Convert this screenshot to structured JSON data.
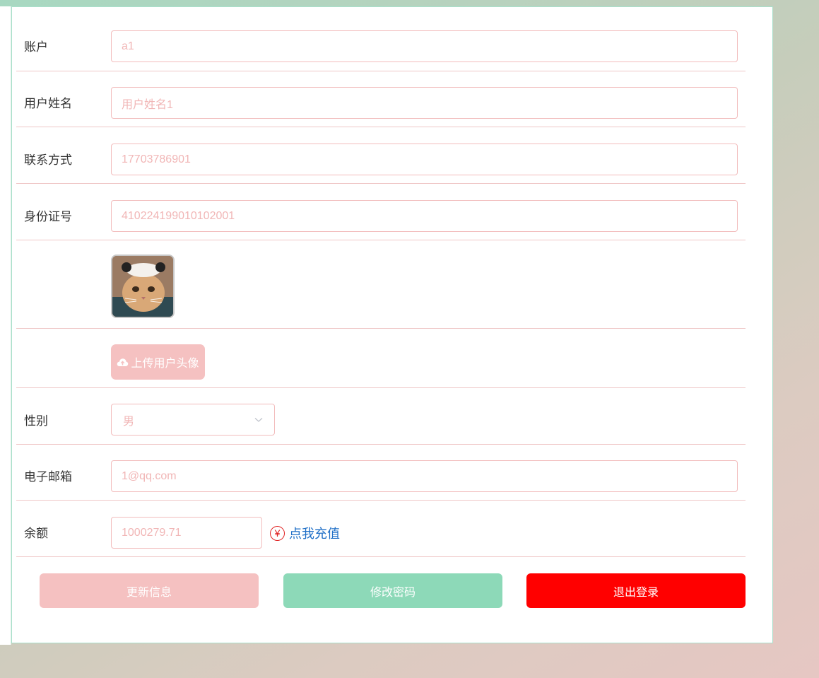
{
  "form": {
    "account": {
      "label": "账户",
      "value": "a1"
    },
    "username": {
      "label": "用户姓名",
      "value": "用户姓名1"
    },
    "phone": {
      "label": "联系方式",
      "value": "17703786901"
    },
    "id_number": {
      "label": "身份证号",
      "value": "410224199010102001"
    },
    "upload_button": "上传用户头像",
    "gender": {
      "label": "性别",
      "value": "男"
    },
    "email": {
      "label": "电子邮箱",
      "value": "1@qq.com"
    },
    "balance": {
      "label": "余额",
      "value": "1000279.71",
      "recharge_label": "点我充值",
      "recharge_icon": "yen-circle-icon"
    }
  },
  "actions": {
    "update_label": "更新信息",
    "change_password_label": "修改密码",
    "logout_label": "退出登录"
  },
  "colors": {
    "update": "#f5c1c1",
    "change_password": "#8dd9b8",
    "logout": "#ff0000",
    "link": "#1f6fc7"
  }
}
